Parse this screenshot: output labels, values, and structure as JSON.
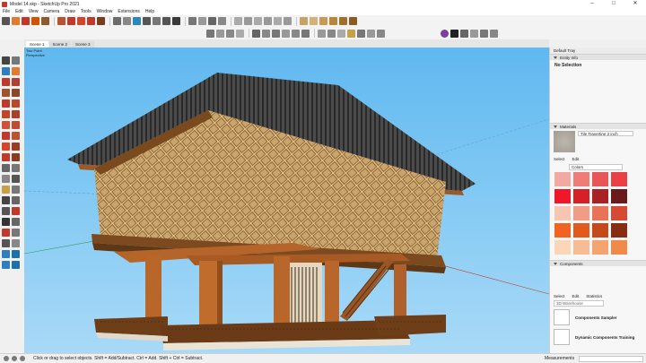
{
  "window": {
    "title": "Model 14.skp - SketchUp Pro 2021",
    "controls": [
      "–",
      "□",
      "✕"
    ]
  },
  "menu": [
    "File",
    "Edit",
    "View",
    "Camera",
    "Draw",
    "Tools",
    "Window",
    "Extensions",
    "Help"
  ],
  "scenes": [
    "Scene 1",
    "Scene 2",
    "Scene 3"
  ],
  "viewport": {
    "camera_line1": "Two Point",
    "camera_line2": "Perspective",
    "sky_color": "#6dc0f2"
  },
  "tray": {
    "title": "Default Tray",
    "entity_info": {
      "header": "Entity Info",
      "selection": "No Selection"
    },
    "materials": {
      "header": "Materials",
      "name": "Tile Travertine 2 inch",
      "tabs": [
        "Select",
        "Edit"
      ],
      "library": "Colors",
      "swatches": [
        "#f2a9a3",
        "#ef7c77",
        "#e8565a",
        "#ea3f45",
        "#f0172a",
        "#d61f26",
        "#a92124",
        "#6b1a1b",
        "#f6c6b3",
        "#f09d88",
        "#e87357",
        "#d64a35",
        "#f26322",
        "#e25b1d",
        "#c64a19",
        "#8a2c12",
        "#fbd6b8",
        "#f8bc94",
        "#f4a470",
        "#f08a48"
      ]
    },
    "components": {
      "header": "Components",
      "tabs": [
        "Select",
        "Edit",
        "Statistics"
      ],
      "search_placeholder": "3D Warehouse",
      "items": [
        "Components Sampler",
        "Dynamic Components Training"
      ]
    }
  },
  "status": {
    "message": "Click or drag to select objects. Shift = Add/Subtract. Ctrl = Add. Shift + Ctrl = Subtract.",
    "measurements_label": "Measurements"
  }
}
